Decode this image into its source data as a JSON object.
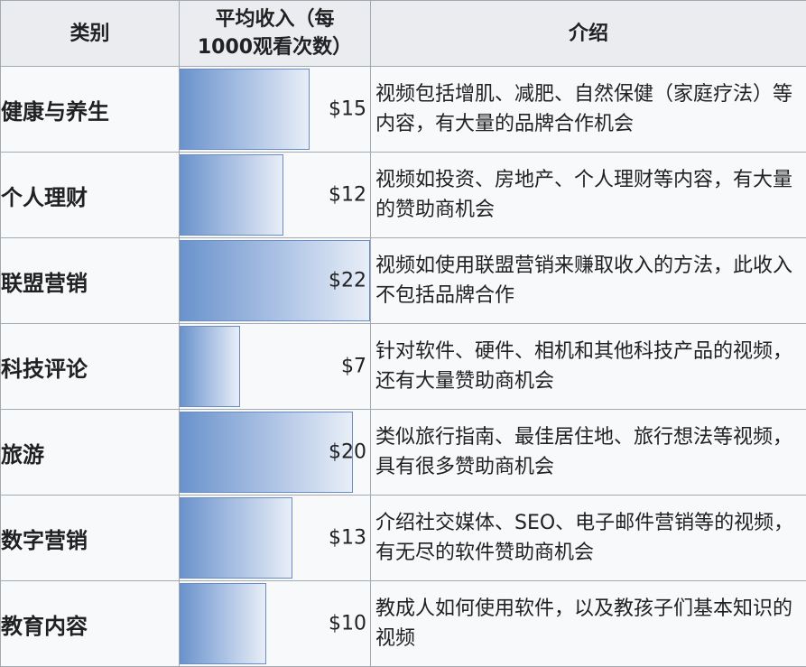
{
  "headers": {
    "category": "类别",
    "income_line1": "平均收入（每",
    "income_line2": "1000观看次数）",
    "intro": "介绍"
  },
  "colors": {
    "bar_start": "#6a93cc",
    "bar_end": "#e8eef7",
    "bar_border": "#6a8cc2",
    "header_bg": "#eaecf0",
    "cell_bg": "#f8f9fa",
    "border": "#a2a9b1"
  },
  "chart_data": {
    "type": "table",
    "max_value": 22,
    "rows": [
      {
        "category": "健康与养生",
        "value": 15,
        "label": "$15",
        "description": "视频包括增肌、减肥、自然保健（家庭疗法）等内容，有大量的品牌合作机会"
      },
      {
        "category": "个人理财",
        "value": 12,
        "label": "$12",
        "description": "视频如投资、房地产、个人理财等内容，有大量的赞助商机会"
      },
      {
        "category": "联盟营销",
        "value": 22,
        "label": "$22",
        "description": "视频如使用联盟营销来赚取收入的方法，此收入不包括品牌合作"
      },
      {
        "category": "科技评论",
        "value": 7,
        "label": "$7",
        "description": "针对软件、硬件、相机和其他科技产品的视频，还有大量赞助商机会"
      },
      {
        "category": "旅游",
        "value": 20,
        "label": "$20",
        "description": "类似旅行指南、最佳居住地、旅行想法等视频，具有很多赞助商机会"
      },
      {
        "category": "数字营销",
        "value": 13,
        "label": "$13",
        "description": "介绍社交媒体、SEO、电子邮件营销等的视频，有无尽的软件赞助商机会"
      },
      {
        "category": "教育内容",
        "value": 10,
        "label": "$10",
        "description": "教成人如何使用软件，以及教孩子们基本知识的视频"
      }
    ]
  }
}
